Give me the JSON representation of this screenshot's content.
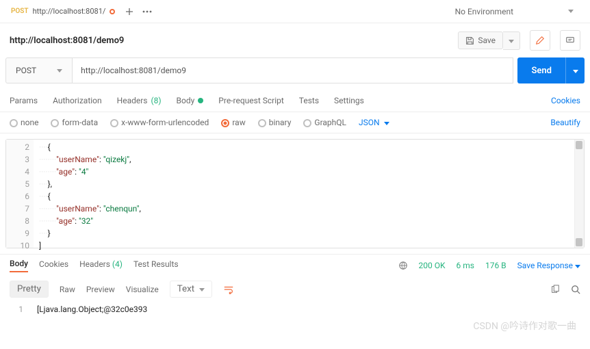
{
  "topTab": {
    "method": "POST",
    "title": "http://localhost:8081/"
  },
  "environment": "No Environment",
  "breadcrumb": "http://localhost:8081/demo9",
  "saveLabel": "Save",
  "method": "POST",
  "url": "http://localhost:8081/demo9",
  "sendLabel": "Send",
  "reqTabs": {
    "params": "Params",
    "auth": "Authorization",
    "headers": "Headers",
    "headersCount": "(8)",
    "body": "Body",
    "pre": "Pre-request Script",
    "tests": "Tests",
    "settings": "Settings",
    "cookies": "Cookies"
  },
  "bodyTypes": {
    "none": "none",
    "form": "form-data",
    "xform": "x-www-form-urlencoded",
    "raw": "raw",
    "binary": "binary",
    "graphql": "GraphQL",
    "format": "JSON",
    "beautify": "Beautify"
  },
  "codeLines": [
    {
      "n": 2,
      "t": "····{"
    },
    {
      "n": 3,
      "t": "········\"userName\": \"qizekj\","
    },
    {
      "n": 4,
      "t": "········\"age\": \"4\""
    },
    {
      "n": 5,
      "t": "····},"
    },
    {
      "n": 6,
      "t": "····{"
    },
    {
      "n": 7,
      "t": "········\"userName\": \"chenqun\","
    },
    {
      "n": 8,
      "t": "········\"age\": \"32\""
    },
    {
      "n": 9,
      "t": "····}"
    },
    {
      "n": 10,
      "t": "]"
    }
  ],
  "respTabs": {
    "body": "Body",
    "cookies": "Cookies",
    "headers": "Headers",
    "headersCount": "(4)",
    "tests": "Test Results"
  },
  "status": {
    "code": "200 OK",
    "time": "6 ms",
    "size": "176 B",
    "save": "Save Response"
  },
  "respViews": {
    "pretty": "Pretty",
    "raw": "Raw",
    "preview": "Preview",
    "visualize": "Visualize",
    "type": "Text"
  },
  "respBody": {
    "line": "1",
    "text": "[Ljava.lang.Object;@32c0e393"
  },
  "watermark": "CSDN @吟诗作对歌一曲"
}
